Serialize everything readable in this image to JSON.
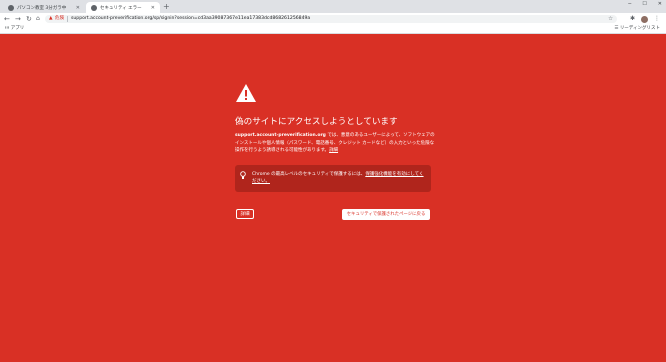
{
  "tabs": [
    {
      "title": "パソコン教室 3分ガラ中",
      "active": false
    },
    {
      "title": "セキュリティ エラー",
      "active": true
    }
  ],
  "omnibox": {
    "security_label": "危険",
    "url": "support.account-preverification.org/sp/signin?session=cd3aa39087367e11ea17383dcd868261256849a"
  },
  "bookmarks": {
    "apps": "アプリ",
    "reading_list": "リーディングリスト"
  },
  "interstitial": {
    "heading": "偽のサイトにアクセスしようとしています",
    "site": "support.account-preverification.org",
    "body": " では、悪意のあるユーザーによって、ソフトウェアのインストールや個人情報（パスワード、電話番号、クレジット カードなど）の入力といった危険な操作を行うよう誘導される可能性があります。",
    "details_link": "詳細",
    "enhanced_text": "Chrome の最高レベルのセキュリティで保護するには、",
    "enhanced_link": "保護強化機能を有効にしてください。",
    "details_button": "詳細",
    "back_button": "セキュリティで保護されたページに戻る"
  },
  "colors": {
    "background": "#d93025",
    "panel": "#b0251c"
  }
}
